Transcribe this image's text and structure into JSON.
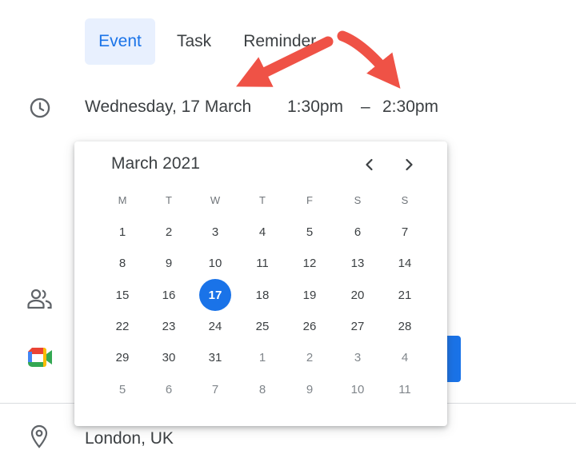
{
  "tabs": [
    {
      "label": "Event",
      "active": true
    },
    {
      "label": "Task",
      "active": false
    },
    {
      "label": "Reminder",
      "active": false
    }
  ],
  "datetime": {
    "date": "Wednesday, 17 March",
    "start": "1:30pm",
    "dash": "–",
    "end": "2:30pm"
  },
  "calendar": {
    "month_title": "March 2021",
    "weekdays": [
      "M",
      "T",
      "W",
      "T",
      "F",
      "S",
      "S"
    ],
    "weeks": [
      [
        "1",
        "2",
        "3",
        "4",
        "5",
        "6",
        "7"
      ],
      [
        "8",
        "9",
        "10",
        "11",
        "12",
        "13",
        "14"
      ],
      [
        "15",
        "16",
        "17",
        "18",
        "19",
        "20",
        "21"
      ],
      [
        "22",
        "23",
        "24",
        "25",
        "26",
        "27",
        "28"
      ],
      [
        "29",
        "30",
        "31",
        "1",
        "2",
        "3",
        "4"
      ],
      [
        "5",
        "6",
        "7",
        "8",
        "9",
        "10",
        "11"
      ]
    ],
    "selected": "17"
  },
  "location": "London, UK",
  "icons": {
    "clock": "clock-icon",
    "people": "people-icon",
    "meet": "google-meet-icon",
    "location": "location-pin-icon",
    "prev": "chevron-left-icon",
    "next": "chevron-right-icon"
  },
  "colors": {
    "accent": "#1a73e8",
    "tab_bg": "#e8f0fe",
    "annotation_arrow": "#ef5246"
  }
}
